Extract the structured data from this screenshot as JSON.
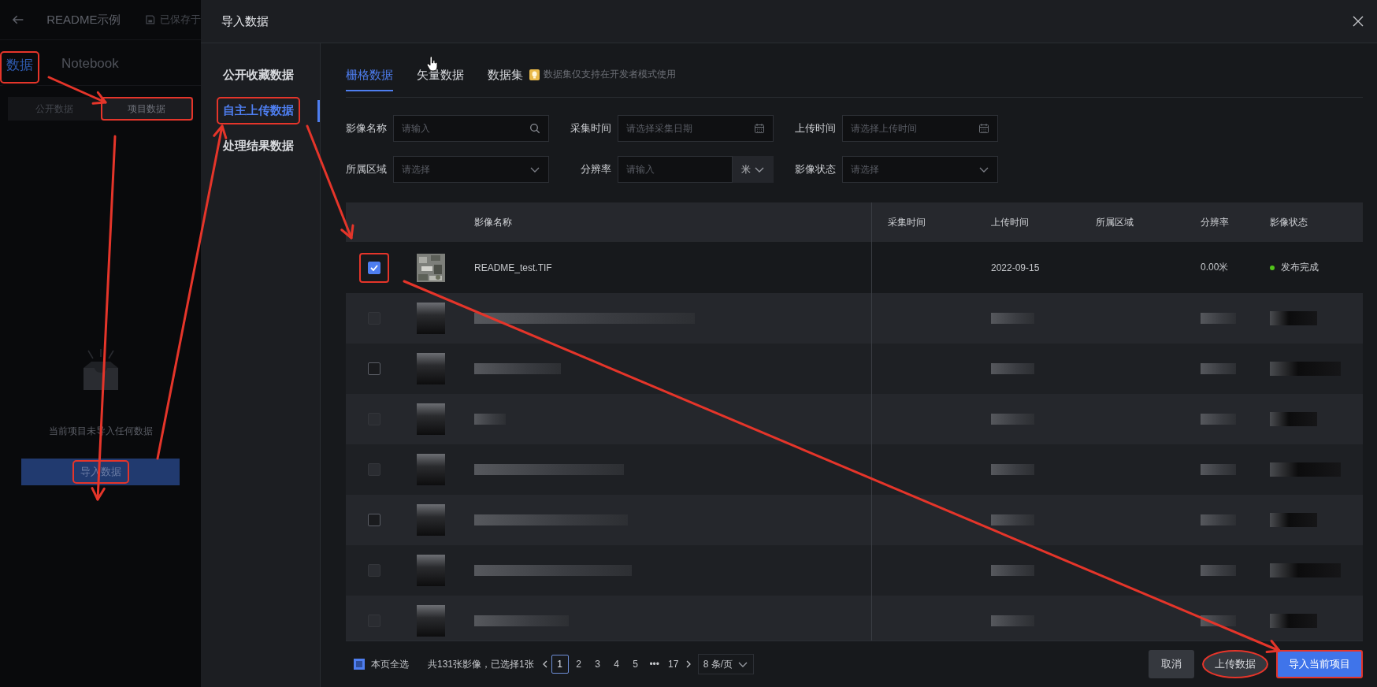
{
  "left_panel": {
    "title": "README示例",
    "save_status": "已保存于",
    "tabs": [
      {
        "label": "数据",
        "selected": true,
        "highlighted": true
      },
      {
        "label": "Notebook",
        "selected": false,
        "highlighted": false
      }
    ],
    "segments": [
      {
        "label": "公开数据",
        "selected": false,
        "highlighted": false
      },
      {
        "label": "项目数据",
        "selected": true,
        "highlighted": true
      }
    ],
    "empty_message": "当前项目未导入任何数据",
    "import_button": {
      "label": "导入数据",
      "highlighted": true
    }
  },
  "dialog": {
    "title": "导入数据",
    "nav": [
      {
        "label": "公开收藏数据",
        "selected": false,
        "highlighted": false
      },
      {
        "label": "自主上传数据",
        "selected": true,
        "highlighted": true
      },
      {
        "label": "处理结果数据",
        "selected": false,
        "highlighted": false
      }
    ],
    "tabs": [
      {
        "label": "栅格数据",
        "selected": true
      },
      {
        "label": "矢量数据",
        "selected": false
      },
      {
        "label": "数据集",
        "selected": false
      }
    ],
    "tip": "数据集仅支持在开发者模式使用",
    "filters": [
      {
        "label": "影像名称",
        "placeholder": "请输入",
        "kind": "search"
      },
      {
        "label": "采集时间",
        "placeholder": "请选择采集日期",
        "kind": "date"
      },
      {
        "label": "上传时间",
        "placeholder": "请选择上传时间",
        "kind": "date"
      },
      {
        "label": "所属区域",
        "placeholder": "请选择",
        "kind": "select"
      },
      {
        "label": "分辨率",
        "placeholder": "请输入",
        "kind": "unit",
        "unit": "米"
      },
      {
        "label": "影像状态",
        "placeholder": "请选择",
        "kind": "select"
      }
    ],
    "table": {
      "columns": [
        "影像名称",
        "采集时间",
        "上传时间",
        "所属区域",
        "分辨率",
        "影像状态"
      ],
      "rows": [
        {
          "checked": true,
          "highlighted": true,
          "name": "README_test.TIF",
          "upload_time": "2022-09-15",
          "resolution": "0.00米",
          "status": {
            "text": "发布完成",
            "color": "#52c41a"
          }
        },
        {
          "kind": "redacted",
          "checked": false,
          "disabled": true
        },
        {
          "kind": "redacted",
          "checked": false,
          "disabled": false
        },
        {
          "kind": "redacted",
          "checked": false,
          "disabled": true
        },
        {
          "kind": "redacted",
          "checked": false,
          "disabled": true
        },
        {
          "kind": "redacted",
          "checked": false,
          "disabled": false
        },
        {
          "kind": "redacted",
          "checked": false,
          "disabled": true
        },
        {
          "kind": "redacted",
          "checked": false,
          "disabled": true
        }
      ]
    },
    "footer": {
      "select_all": {
        "label": "本页全选",
        "indeterminate": true
      },
      "summary": "共131张影像，已选择1张",
      "pages": [
        {
          "label": "1",
          "selected": true
        },
        {
          "label": "2",
          "selected": false
        },
        {
          "label": "3",
          "selected": false
        },
        {
          "label": "4",
          "selected": false
        },
        {
          "label": "5",
          "selected": false
        },
        {
          "label": "•••",
          "selected": false
        },
        {
          "label": "17",
          "selected": false
        }
      ],
      "page_size": "8 条/页",
      "buttons": [
        {
          "label": "取消",
          "kind": "default",
          "highlighted": false
        },
        {
          "label": "上传数据",
          "kind": "default",
          "highlighted": true
        },
        {
          "label": "导入当前项目",
          "kind": "primary",
          "highlighted": true
        }
      ]
    }
  }
}
